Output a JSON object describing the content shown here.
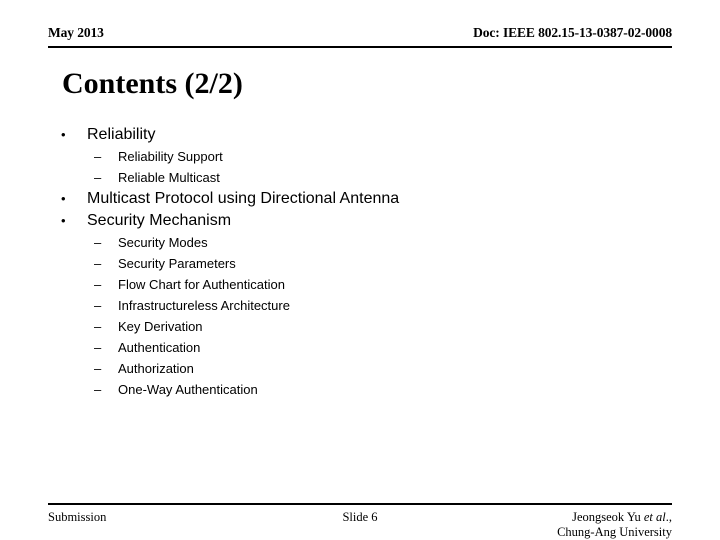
{
  "header": {
    "date": "May 2013",
    "doc": "Doc: IEEE 802.15-13-0387-02-0008"
  },
  "title": "Contents (2/2)",
  "outline": {
    "bullet_marker": "•",
    "dash_marker": "–",
    "items": [
      {
        "level": 1,
        "text": "Reliability"
      },
      {
        "level": 2,
        "text": "Reliability Support"
      },
      {
        "level": 2,
        "text": "Reliable Multicast"
      },
      {
        "level": 1,
        "text": "Multicast Protocol using Directional Antenna"
      },
      {
        "level": 1,
        "text": "Security Mechanism"
      },
      {
        "level": 2,
        "text": "Security Modes"
      },
      {
        "level": 2,
        "text": "Security Parameters"
      },
      {
        "level": 2,
        "text": "Flow Chart for Authentication"
      },
      {
        "level": 2,
        "text": "Infrastructureless Architecture"
      },
      {
        "level": 2,
        "text": "Key Derivation"
      },
      {
        "level": 2,
        "text": "Authentication"
      },
      {
        "level": 2,
        "text": "Authorization"
      },
      {
        "level": 2,
        "text": "One-Way Authentication"
      }
    ]
  },
  "footer": {
    "left": "Submission",
    "center": "Slide 6",
    "right_author_prefix": "Jeongseok Yu ",
    "right_author_italic": "et al",
    "right_author_suffix": ".,",
    "right_affiliation": "Chung-Ang University"
  }
}
